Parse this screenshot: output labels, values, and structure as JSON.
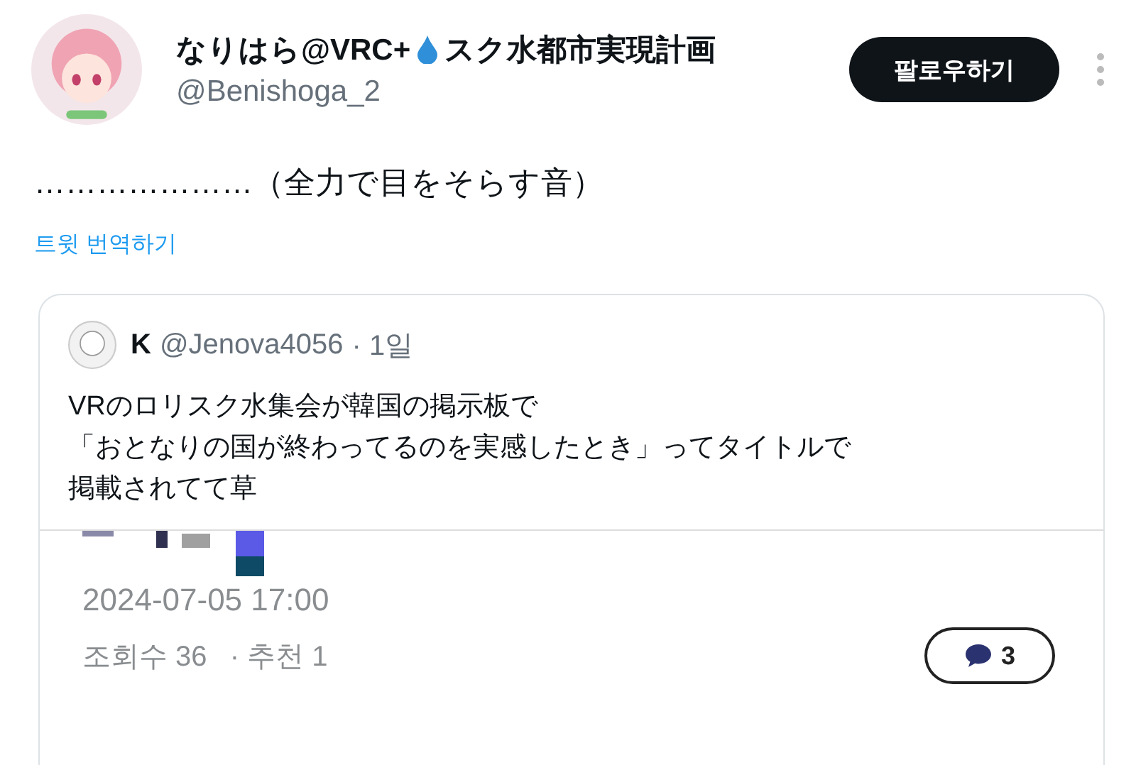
{
  "author": {
    "name_before_icon": "なりはら@VRC+",
    "name_after_icon": "スク水都市実現計画",
    "handle": "@Benishoga_2"
  },
  "follow_button": "팔로우하기",
  "tweet_text": "…………………（全力で目をそらす音）",
  "translate_link": "트윗 번역하기",
  "quoted_tweet": {
    "name": "K",
    "handle": "@Jenova4056",
    "time": "· 1일",
    "lines": [
      "VRのロリスク水集会が韓国の掲示板で",
      "「おとなりの国が終わってるのを実感したとき」ってタイトルで",
      "掲載されてて草"
    ],
    "embedded_screenshot": {
      "date": "2024-07-05 17:00",
      "views": "조회수 36",
      "recommends": "· 추천 1",
      "comments": "3"
    }
  }
}
